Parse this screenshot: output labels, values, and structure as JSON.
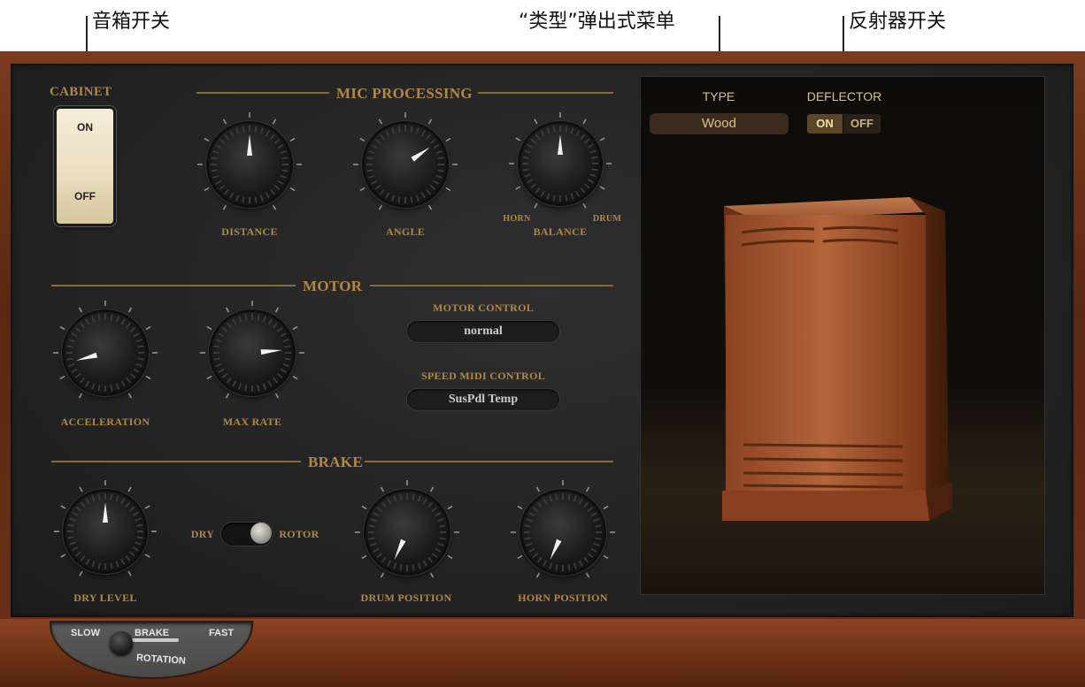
{
  "callouts": {
    "cabinet_switch": "音箱开关",
    "type_menu": "“类型”弹出式菜单",
    "deflector_switch": "反射器开关"
  },
  "cabinet": {
    "title": "CABINET",
    "on": "ON",
    "off": "OFF"
  },
  "mic_processing": {
    "title": "MIC PROCESSING",
    "distance": "DISTANCE",
    "angle": "ANGLE",
    "balance": "BALANCE",
    "horn": "HORN",
    "drum": "DRUM"
  },
  "motor": {
    "title": "MOTOR",
    "acceleration": "ACCELERATION",
    "max_rate": "MAX RATE",
    "motor_control_label": "MOTOR CONTROL",
    "motor_control_value": "normal",
    "speed_midi_label": "SPEED MIDI CONTROL",
    "speed_midi_value": "SusPdl Temp"
  },
  "brake": {
    "title": "BRAKE",
    "dry_level": "DRY LEVEL",
    "dry": "DRY",
    "rotor": "ROTOR",
    "drum_position": "DRUM POSITION",
    "horn_position": "HORN POSITION"
  },
  "display": {
    "type_label": "TYPE",
    "type_value": "Wood",
    "deflector_label": "DEFLECTOR",
    "deflector_on": "ON",
    "deflector_off": "OFF"
  },
  "rotation": {
    "slow": "SLOW",
    "brake": "BRAKE",
    "fast": "FAST",
    "label": "ROTATION"
  },
  "colors": {
    "gold": "#b08848",
    "wood": "#7a3a1e",
    "panel": "#232323"
  }
}
